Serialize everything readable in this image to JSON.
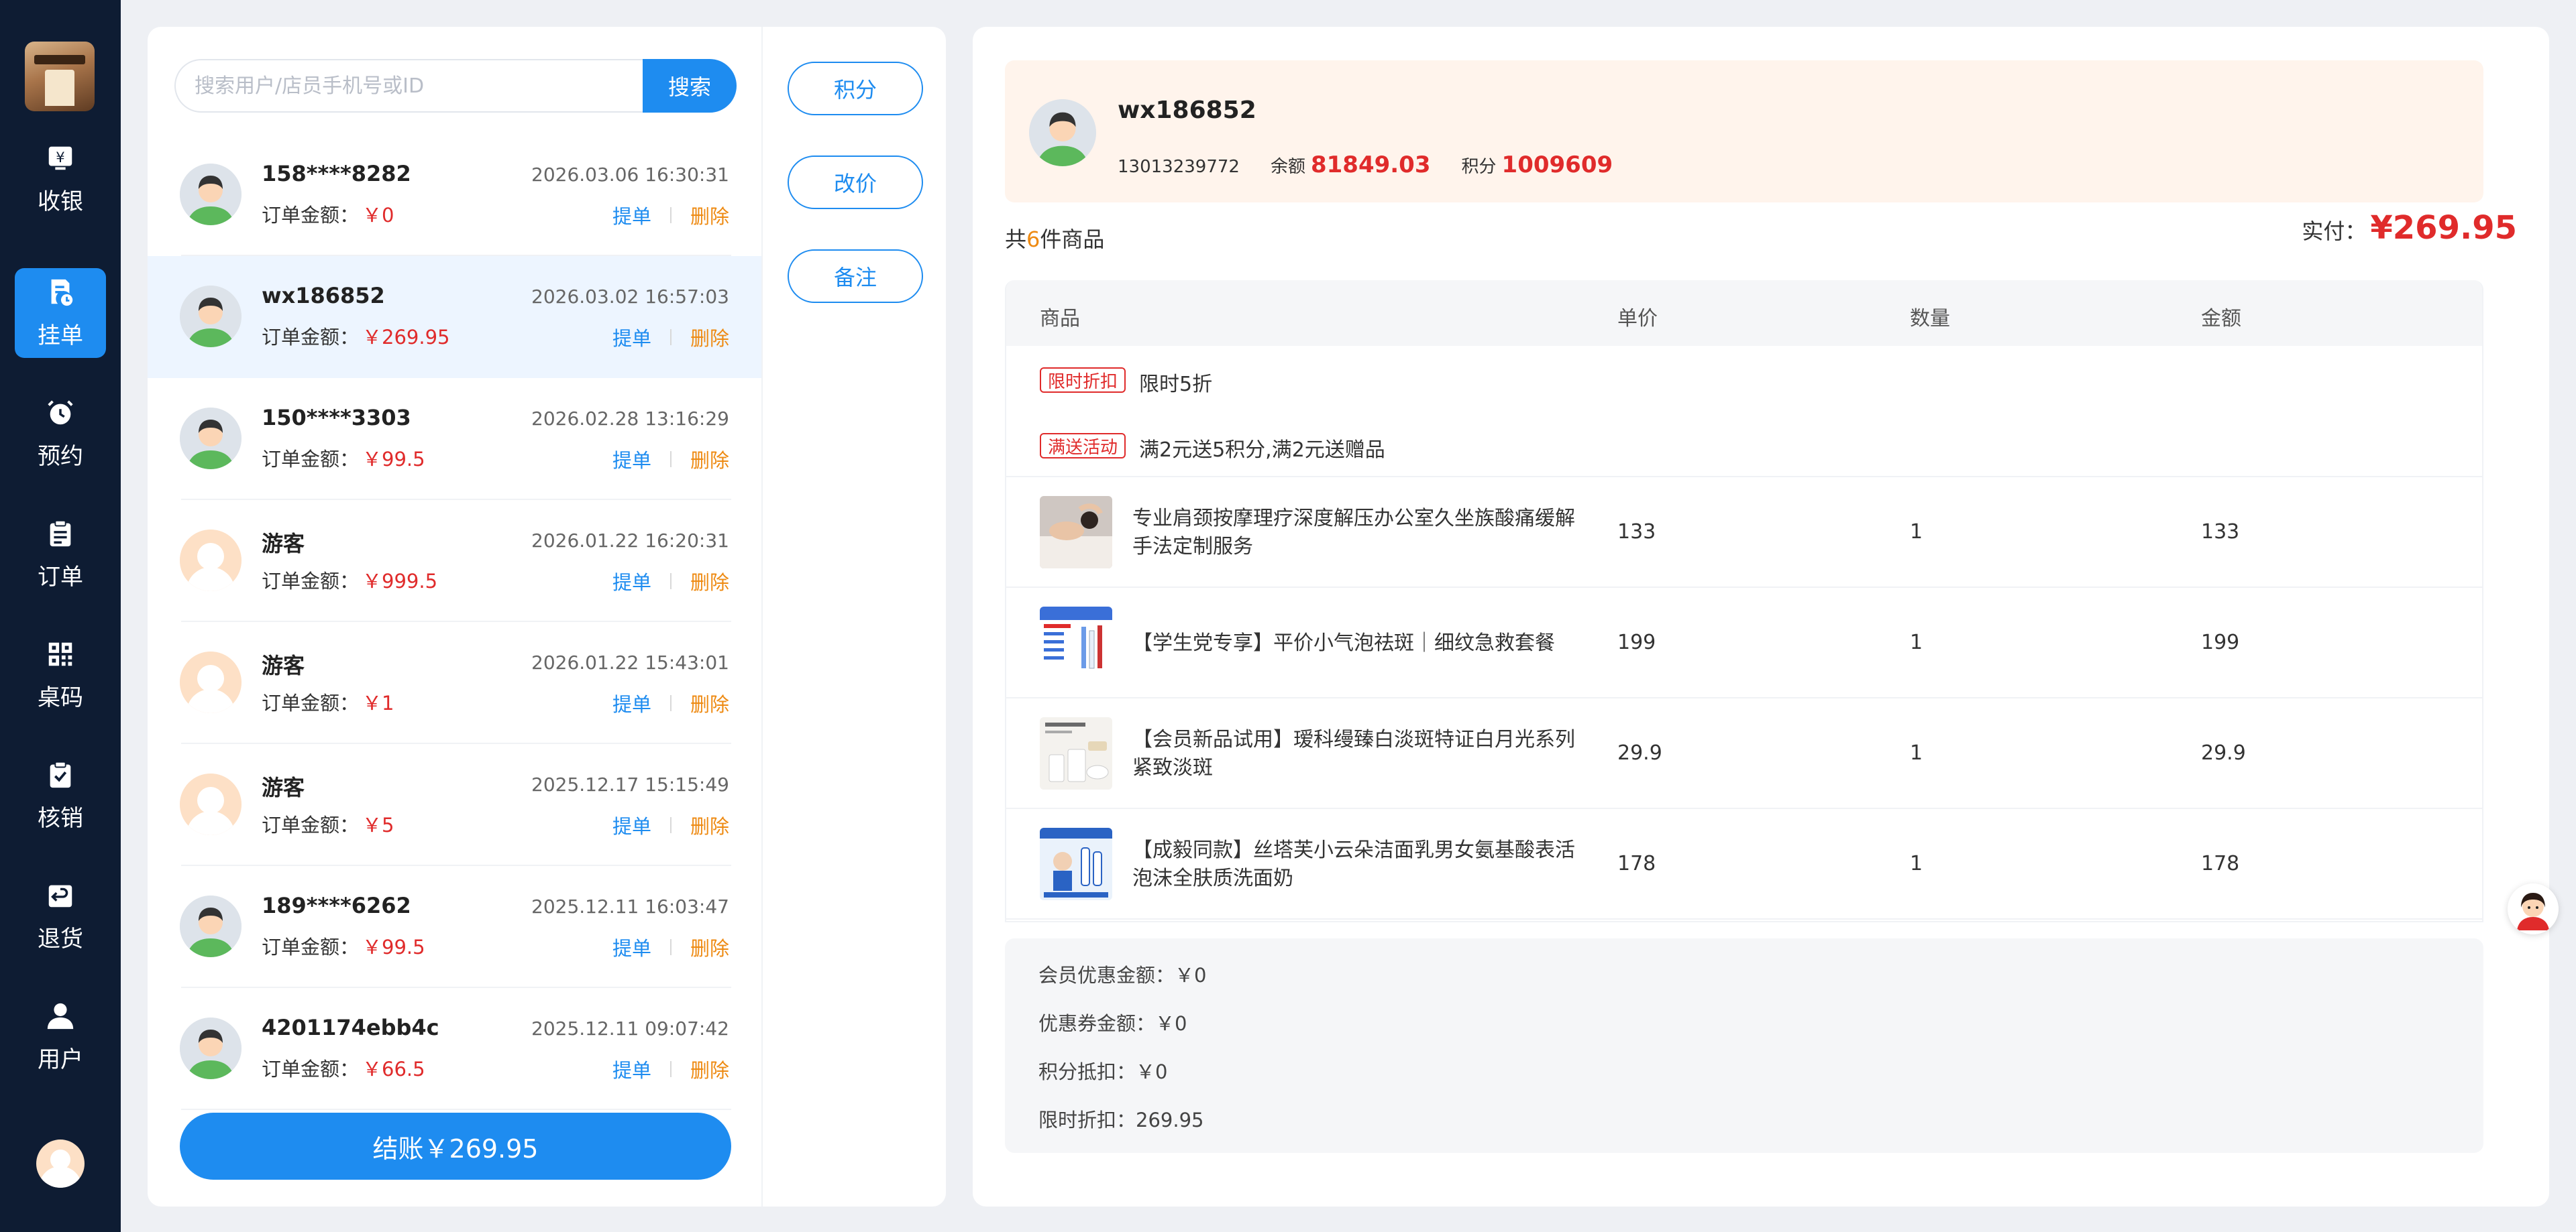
{
  "nav": {
    "items": [
      {
        "label": "收银",
        "icon": "cashier-icon",
        "active": false
      },
      {
        "label": "挂单",
        "icon": "pending-order-icon",
        "active": true
      },
      {
        "label": "预约",
        "icon": "alarm-clock-icon",
        "active": false
      },
      {
        "label": "订单",
        "icon": "clipboard-icon",
        "active": false
      },
      {
        "label": "桌码",
        "icon": "qr-code-icon",
        "active": false
      },
      {
        "label": "核销",
        "icon": "verify-check-icon",
        "active": false
      },
      {
        "label": "退货",
        "icon": "return-icon",
        "active": false
      },
      {
        "label": "用户",
        "icon": "user-icon",
        "active": false
      }
    ]
  },
  "search": {
    "placeholder": "搜索用户/店员手机号或ID",
    "button": "搜索"
  },
  "orders": [
    {
      "name": "158****8282",
      "time": "2026.03.06 16:30:31",
      "amount_label": "订单金额：",
      "amount": "￥0",
      "avatar": "user"
    },
    {
      "name": "wx186852",
      "time": "2026.03.02 16:57:03",
      "amount_label": "订单金额：",
      "amount": "￥269.95",
      "avatar": "user",
      "selected": true
    },
    {
      "name": "150****3303",
      "time": "2026.02.28 13:16:29",
      "amount_label": "订单金额：",
      "amount": "￥99.5",
      "avatar": "user"
    },
    {
      "name": "游客",
      "time": "2026.01.22 16:20:31",
      "amount_label": "订单金额：",
      "amount": "￥999.5",
      "avatar": "guest"
    },
    {
      "name": "游客",
      "time": "2026.01.22 15:43:01",
      "amount_label": "订单金额：",
      "amount": "￥1",
      "avatar": "guest"
    },
    {
      "name": "游客",
      "time": "2025.12.17 15:15:49",
      "amount_label": "订单金额：",
      "amount": "￥5",
      "avatar": "guest"
    },
    {
      "name": "189****6262",
      "time": "2025.12.11 16:03:47",
      "amount_label": "订单金额：",
      "amount": "￥99.5",
      "avatar": "user"
    },
    {
      "name": "4201174ebb4c",
      "time": "2025.12.11 09:07:42",
      "amount_label": "订单金额：",
      "amount": "￥66.5",
      "avatar": "user"
    }
  ],
  "order_actions": {
    "pick": "提单",
    "delete": "删除"
  },
  "checkout": "结账￥269.95",
  "side_buttons": [
    "积分",
    "改价",
    "备注"
  ],
  "member": {
    "name": "wx186852",
    "phone": "13013239772",
    "balance_label": "余额",
    "balance": "81849.03",
    "points_label": "积分",
    "points": "1009609"
  },
  "goods": {
    "prefix": "共",
    "count": "6",
    "suffix": "件商品"
  },
  "paid": {
    "label": "实付：",
    "value": "¥269.95"
  },
  "table": {
    "headers": [
      "商品",
      "单价",
      "数量",
      "金额"
    ],
    "promos": [
      {
        "tag": "限时折扣",
        "text": "限时5折"
      },
      {
        "tag": "满送活动",
        "text": "满2元送5积分,满2元送赠品"
      }
    ],
    "rows": [
      {
        "name": "专业肩颈按摩理疗深度解压办公室久坐族酸痛缓解手法定制服务",
        "price": "133",
        "qty": "1",
        "amount": "133"
      },
      {
        "name": "【学生党专享】平价小气泡祛斑｜细纹急救套餐",
        "price": "199",
        "qty": "1",
        "amount": "199"
      },
      {
        "name": "【会员新品试用】瑷科缦臻白淡斑特证白月光系列 紧致淡斑",
        "price": "29.9",
        "qty": "1",
        "amount": "29.9"
      },
      {
        "name": "【成毅同款】丝塔芙小云朵洁面乳男女氨基酸表活泡沫全肤质洗面奶",
        "price": "178",
        "qty": "1",
        "amount": "178"
      }
    ]
  },
  "summary": [
    "会员优惠金额：￥0",
    "优惠券金额：￥0",
    "积分抵扣：￥0",
    "限时折扣：269.95"
  ],
  "colors": {
    "primary": "#1e8cf0",
    "nav_bg": "#0e1c33",
    "price_red": "#e02b2b",
    "delete_orange": "#ee8a12",
    "member_bg": "#fff4ec"
  }
}
